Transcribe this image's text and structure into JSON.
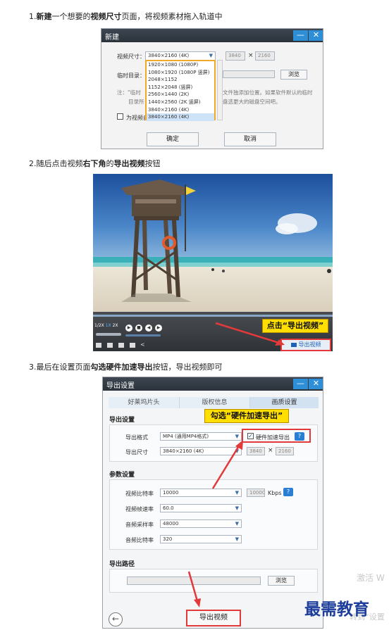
{
  "steps": {
    "s1": {
      "num": "1.",
      "a": "新建",
      "b": "一个想要的",
      "c": "视频尺寸",
      "d": "页面，将视频素材拖入轨道中"
    },
    "s2": {
      "num": "2.",
      "a": "随后点击视频",
      "b": "右下角",
      "c": "的",
      "d": "导出视频",
      "e": "按钮"
    },
    "s3": {
      "num": "3.",
      "a": "最后在设置页面",
      "b": "勾选硬件加速导出",
      "c": "按钮，导出视频即可"
    }
  },
  "new_dialog": {
    "title": "新建",
    "min_btn": "—",
    "close_btn": "✕",
    "size_label": "视频尺寸：",
    "size_value": "3840×2160 (4K)",
    "width": "3840",
    "times": "×",
    "height": "2160",
    "temp_dir_label": "临时目录：",
    "browse": "浏览",
    "note_prefix": "注：“临时",
    "note_line1_suffix": "文件独添加位置。如果软件默认的临时",
    "note_line2_prefix": "目录所",
    "note_line2_suffix": "盘选更大的磁盘空间吧。",
    "checkbox_label": "为视频自",
    "ok": "确定",
    "cancel": "取消",
    "options": [
      "1920×1080 (1080P)",
      "1080×1920 (1080P 竖屏)",
      "2048×1152",
      "1152×2048 (竖屏)",
      "2560×1440 (2K)",
      "1440×2560 (2K 竖屏)",
      "3840×2160 (4K)"
    ]
  },
  "video": {
    "speeds": [
      "1/2X",
      "1X",
      "2X"
    ],
    "callout": "点击“导出视频”",
    "export_btn": "导出视频",
    "export_icon": "film-export-icon"
  },
  "export_dialog": {
    "title": "导出设置",
    "min_btn": "—",
    "close_btn": "✕",
    "tabs": [
      "好莱坞片头",
      "版权信息",
      "画质设置"
    ],
    "section_export": "导出设置",
    "format_label": "导出格式",
    "format_value": "MP4 (通用MP4格式)",
    "hw_accel_label": "硬件加速导出",
    "hw_accel_checked": "✓",
    "help": "?",
    "size_label": "导出尺寸",
    "size_value": "3840×2160 (4K)",
    "width": "3840",
    "times": "×",
    "height": "2160",
    "callout": "勾选“硬件加速导出”",
    "section_params": "参数设置",
    "video_bitrate_label": "视频比特率",
    "video_bitrate_value": "10000",
    "video_bitrate_field": "10000",
    "kbps": "Kbps",
    "fps_label": "视频帧速率",
    "fps_value": "60.0",
    "audio_sample_label": "音频采样率",
    "audio_sample_value": "48000",
    "audio_bitrate_label": "音频比特率",
    "audio_bitrate_value": "320",
    "section_path": "导出路径",
    "browse": "浏览",
    "back_icon": "←",
    "export_button": "导出视频"
  },
  "watermark": {
    "logo": "最需教育",
    "faint1": "激活 W",
    "faint2": "转到“设置"
  },
  "colors": {
    "accent_blue": "#2f8fd6",
    "callout_yellow": "#ffdf00",
    "highlight_red": "#e23a3a",
    "dropdown_border": "#f1a92a",
    "logo_blue": "#1d3e9a"
  }
}
